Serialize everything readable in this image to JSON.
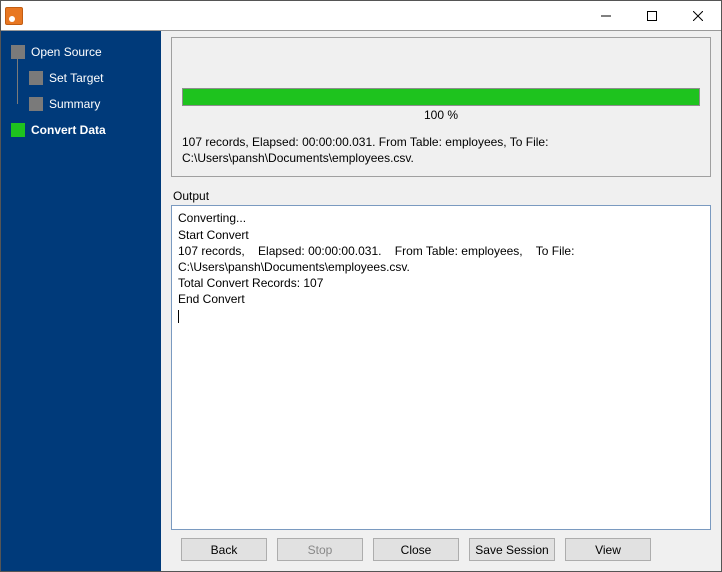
{
  "titlebar": {
    "title": ""
  },
  "sidebar": {
    "items": [
      {
        "label": "Open Source"
      },
      {
        "label": "Set Target"
      },
      {
        "label": "Summary"
      },
      {
        "label": "Convert Data"
      }
    ]
  },
  "progress": {
    "percent_text": "100 %",
    "percent_value": 100
  },
  "summary": "107 records,    Elapsed: 00:00:00.031.    From Table: employees,    To File: C:\\Users\\pansh\\Documents\\employees.csv.",
  "output_label": "Output",
  "output_text": "Converting...\nStart Convert\n107 records,    Elapsed: 00:00:00.031.    From Table: employees,    To File: C:\\Users\\pansh\\Documents\\employees.csv.\nTotal Convert Records: 107\nEnd Convert",
  "buttons": {
    "back": "Back",
    "stop": "Stop",
    "close": "Close",
    "save_session": "Save Session",
    "view": "View"
  }
}
